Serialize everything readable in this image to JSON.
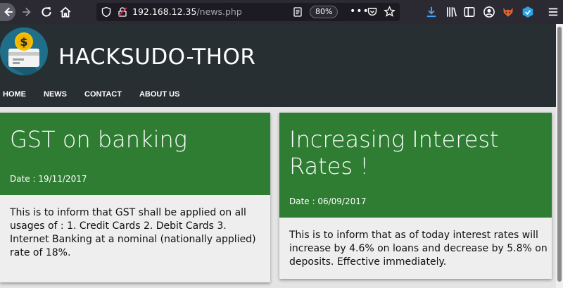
{
  "browser": {
    "url_host": "192.168.12.35",
    "url_path": "/news.php",
    "zoom": "80%",
    "more_label": "•••"
  },
  "site": {
    "title": "HACKSUDO-THOR",
    "nav": [
      "HOME",
      "NEWS",
      "CONTACT",
      "ABOUT US"
    ],
    "logo_icon": "money-card-icon",
    "colors": {
      "header": "#272f33",
      "card_header": "#2e7d32",
      "logo_bg": "#1f6f8b"
    }
  },
  "articles": [
    {
      "title": "GST on banking",
      "date": "Date : 19/11/2017",
      "body": "This is to inform that GST shall be applied on all usages of : 1. Credit Cards 2. Debit Cards 3. Internet Banking at a nominal (nationally applied) rate of 18%."
    },
    {
      "title": "Increasing Interest Rates !",
      "date": "Date : 06/09/2017",
      "body": "This is to inform that as of today interest rates will increase by 4.6% on loans and decrease by 5.8% on deposits. Effective immediately."
    }
  ]
}
